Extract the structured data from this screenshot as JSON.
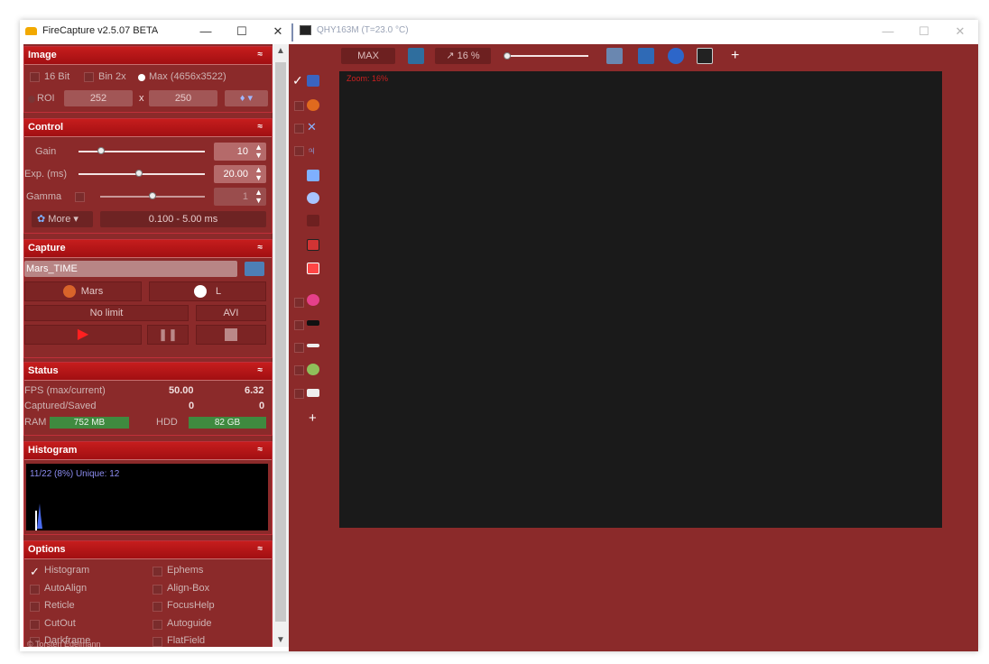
{
  "left_window": {
    "title": "FireCapture v2.5.07 BETA",
    "buttons": {
      "minimize": "—",
      "maximize": "☐",
      "close": "✕"
    }
  },
  "right_window": {
    "title": "QHY163M (T=23.0 °C)",
    "buttons": {
      "minimize": "—",
      "maximize": "☐",
      "close": "✕"
    }
  },
  "image": {
    "header": "Image",
    "chevron": "≈",
    "bit16": "16 Bit",
    "bin2x": "Bin 2x",
    "max": "Max (4656x3522)",
    "roi": "ROI",
    "roi_w": "252",
    "x": "x",
    "roi_h": "250",
    "roi_menu": "♦ ▾"
  },
  "control": {
    "header": "Control",
    "gain_label": "Gain",
    "gain_value": "10",
    "gain_level": 0.18,
    "exp_label": "Exp. (ms)",
    "exp_value": "20.00",
    "exp_level": 0.48,
    "gamma_label": "Gamma",
    "gamma_value": "1",
    "gamma_level": 0.5,
    "more": "More",
    "range": "0.100 - 5.00 ms"
  },
  "capture": {
    "header": "Capture",
    "name": "Mars_TIME",
    "object": "Mars",
    "filter": "L",
    "limit": "No limit",
    "format": "AVI"
  },
  "status": {
    "header": "Status",
    "fps_label": "FPS (max/current)",
    "fps_max": "50.00",
    "fps_current": "6.32",
    "cap_label": "Captured/Saved",
    "captured": "0",
    "saved": "0",
    "ram_label": "RAM",
    "ram": "752 MB",
    "hdd_label": "HDD",
    "hdd": "82 GB"
  },
  "histogram": {
    "header": "Histogram",
    "info": "11/22 (8%)  Unique: 12"
  },
  "options": {
    "header": "Options",
    "left": [
      "Histogram",
      "AutoAlign",
      "Reticle",
      "CutOut",
      "Darkframe"
    ],
    "right": [
      "Ephems",
      "Align-Box",
      "FocusHelp",
      "Autoguide",
      "FlatField"
    ],
    "checked": [
      "Histogram"
    ]
  },
  "footer": "© Torsten Edelmann",
  "toolbar": {
    "max": "MAX",
    "zoom": "↗ 16 %",
    "plus": "+"
  },
  "viewer": {
    "zoom_text": "Zoom: 16%"
  },
  "sidebar_plus": "+",
  "colors": {
    "panel": "#8b2a2a",
    "header": "#b51717",
    "viewer": "#1a1a1a",
    "green": "#3f8a3f"
  }
}
